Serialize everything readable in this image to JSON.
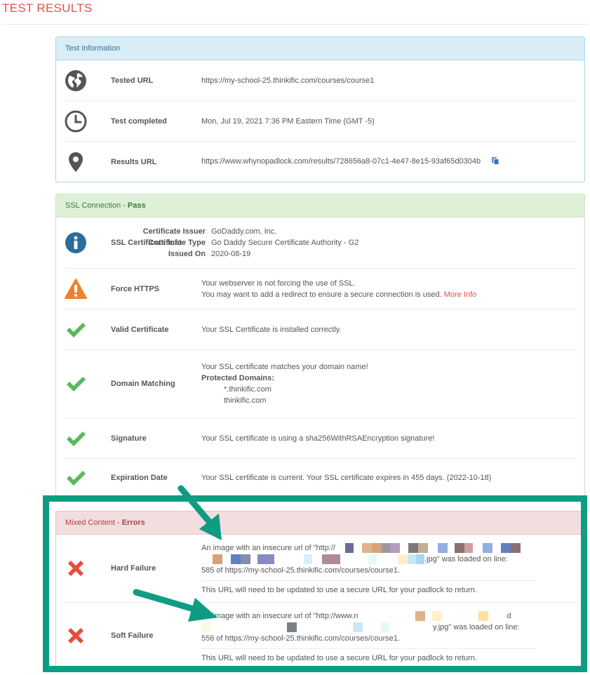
{
  "page": {
    "title": "TEST RESULTS"
  },
  "test_information": {
    "heading": "Test Information",
    "rows": [
      {
        "icon": "globe-icon",
        "label": "Tested URL",
        "value": "https://my-school-25.thinkific.com/courses/course1"
      },
      {
        "icon": "clock-icon",
        "label": "Test completed",
        "value": "Mon, Jul 19, 2021 7:36 PM Eastern Time (GMT -5)"
      },
      {
        "icon": "map-pin-icon",
        "label": "Results URL",
        "value": "https://www.whynopadlock.com/results/728656a8-07c1-4e47-8e15-93af65d0304b"
      }
    ]
  },
  "ssl_connection": {
    "heading": "SSL Connection",
    "status_sep": " - ",
    "status": "Pass",
    "certificate_info": {
      "label": "SSL Certificate Info",
      "issuer_key": "Certificate Issuer",
      "issuer": "GoDaddy.com, Inc.",
      "type_key": "Certificate Type",
      "type": "Go Daddy Secure Certificate Authority - G2",
      "issued_key": "Issued On",
      "issued": "2020-08-19"
    },
    "force_https": {
      "label": "Force HTTPS",
      "line1": "Your webserver is not forcing the use of SSL.",
      "line2": "You may want to add a redirect to ensure a secure connection is used.",
      "link": "More Info"
    },
    "valid_certificate": {
      "label": "Valid Certificate",
      "value": "Your SSL Certificate is installed correctly."
    },
    "domain_matching": {
      "label": "Domain Matching",
      "line1": "Your SSL certificate matches your domain name!",
      "protected_label": "Protected Domains:",
      "domains": [
        "*.thinkific.com",
        "thinkific.com"
      ]
    },
    "signature": {
      "label": "Signature",
      "value": "Your SSL certificate is using a sha256WithRSAEncryption signature!"
    },
    "expiration": {
      "label": "Expiration Date",
      "value": "Your SSL certificate is current. Your SSL certificate expires in 455 days. (2022-10-18)"
    }
  },
  "mixed_content": {
    "heading": "Mixed Content",
    "status_sep": " - ",
    "status": "Errors",
    "hard": {
      "label": "Hard Failure",
      "line1": "An image with an insecure url of \"http://",
      "line2_end": ".jpg\" was loaded on line:",
      "line3": "585 of https://my-school-25.thinkific.com/courses/course1.",
      "note": "This URL will need to be updated to use a secure URL for your padlock to return."
    },
    "soft": {
      "label": "Soft Failure",
      "line1": "An image with an insecure url of \"http://www.n",
      "line1_end": "d",
      "line2_end": "y.jpg\" was loaded on line:",
      "line3": "556 of https://my-school-25.thinkific.com/courses/course1.",
      "note": "This URL will need to be updated to use a secure URL for your padlock to return."
    }
  },
  "colors": {
    "accent_red": "#e0524a",
    "pass_green": "#5cb85c",
    "error_red": "#e74c3c",
    "warning_orange": "#f0802b",
    "annotation_teal": "#0e9c82"
  }
}
